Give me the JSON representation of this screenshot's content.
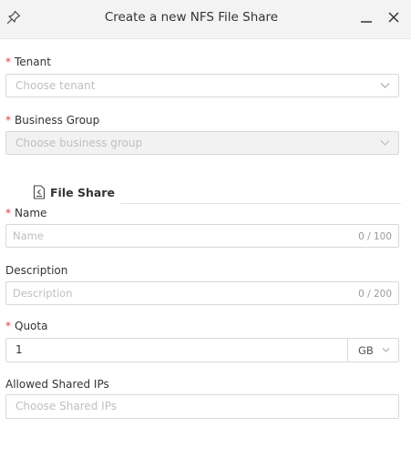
{
  "window": {
    "title": "Create a new NFS File Share",
    "pin_icon": "pin-icon",
    "minimize_icon": "minimize-icon",
    "close_icon": "close-icon"
  },
  "required_marker": "*",
  "form": {
    "tenant": {
      "label": "Tenant",
      "placeholder": "Choose tenant"
    },
    "business_group": {
      "label": "Business Group",
      "placeholder": "Choose business group"
    },
    "section": {
      "title": "File Share",
      "icon": "file-icon"
    },
    "name": {
      "label": "Name",
      "placeholder": "Name",
      "counter": "0 / 100"
    },
    "description": {
      "label": "Description",
      "placeholder": "Description",
      "counter": "0 / 200"
    },
    "quota": {
      "label": "Quota",
      "value": "1",
      "unit": "GB"
    },
    "allowed_ips": {
      "label": "Allowed Shared IPs",
      "placeholder": "Choose Shared IPs"
    }
  },
  "colors": {
    "required": "#e23c39",
    "titlebar_bg": "#f3f3f3",
    "border": "#d9d9d9",
    "disabled_bg": "#f2f2f2",
    "placeholder": "#bfbfbf"
  }
}
